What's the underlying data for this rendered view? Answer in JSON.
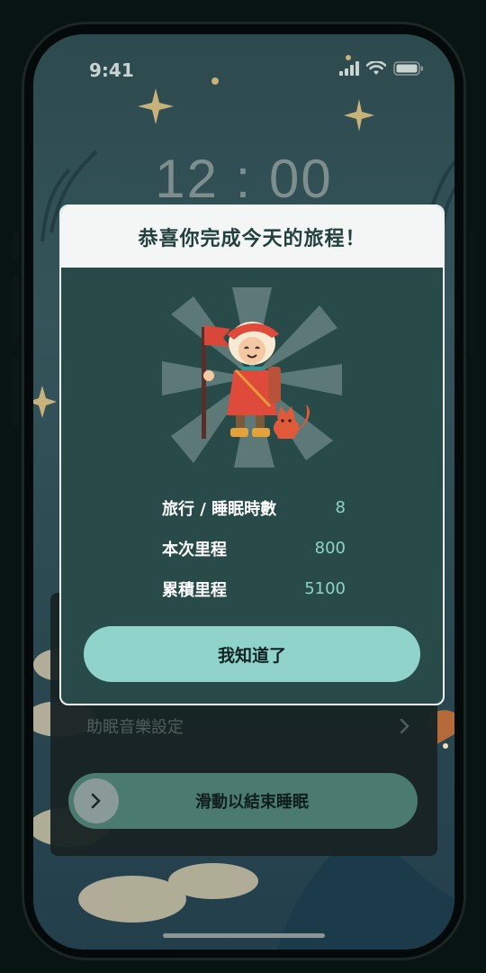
{
  "status_bar": {
    "time": "9:41",
    "icons": [
      "signal-icon",
      "wifi-icon",
      "battery-icon"
    ]
  },
  "clock": {
    "display": "12 : 00"
  },
  "modal": {
    "title": "恭喜你完成今天的旅程！",
    "stats": [
      {
        "label": "旅行 / 睡眠時數",
        "value": "8"
      },
      {
        "label": "本次里程",
        "value": "800"
      },
      {
        "label": "累積里程",
        "value": "5100"
      }
    ],
    "ack_button": "我知道了"
  },
  "bottom_panel": {
    "music_settings": "助眠音樂設定",
    "slider_label": "滑動以結束睡眠"
  },
  "colors": {
    "accent": "#8fd3cb",
    "modal_body": "#284a49",
    "stat_value": "#8fd3c8",
    "slider": "#4b7a70"
  }
}
